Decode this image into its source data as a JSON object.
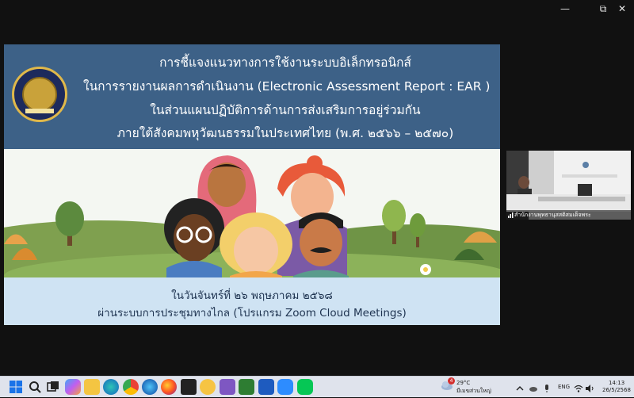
{
  "window": {
    "minimize_label": "—",
    "restore_label": "⧉",
    "close_label": "✕"
  },
  "slide": {
    "title_lines": [
      "การชี้แจงแนวทางการใช้งานระบบอิเล็กทรอนิกส์",
      "ในการรายงานผลการดำเนินงาน (Electronic Assessment Report : EAR )",
      "ในส่วนแผนปฏิบัติการด้านการส่งเสริมการอยู่ร่วมกัน",
      "ภายใต้สังคมพหุวัฒนธรรมในประเทศไทย (พ.ศ. ๒๕๖๖ – ๒๕๗๐)"
    ],
    "footer_lines": [
      "ในวันจันทร์ที่ ๒๖ พฤษภาคม ๒๕๖๘",
      "ผ่านระบบการประชุมทางไกล (โปรแกรม Zoom Cloud Meetings)"
    ]
  },
  "video": {
    "participant_name": "สำนักงานพุทธานุสสติสมเด็จพระ"
  },
  "taskbar": {
    "icons": [
      "windows-start",
      "search",
      "task-view",
      "copilot",
      "file-explorer",
      "edge",
      "chrome",
      "edge-alt",
      "firefox",
      "media",
      "app-yellow",
      "app-purple",
      "app-green",
      "word",
      "zoom",
      "line"
    ],
    "weather_temp": "29°C",
    "weather_desc": "มีเมฆส่วนใหญ่",
    "weather_badge": "4",
    "lang": "ENG",
    "time": "14:13",
    "date": "26/5/2568"
  },
  "colors": {
    "header_bg": "#3d6187",
    "footer_bg": "#cfe3f3",
    "taskbar_bg": "#dfe3ec"
  }
}
